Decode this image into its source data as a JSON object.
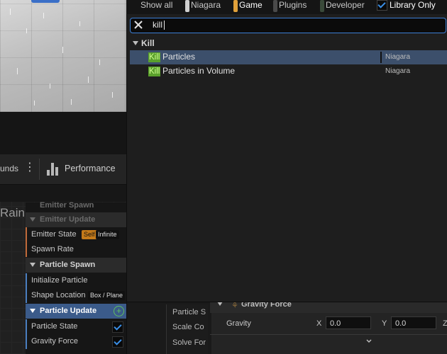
{
  "filter_bar": {
    "show_all": "Show all",
    "filters": [
      {
        "label": "Niagara",
        "color": "#cfcfcf",
        "active": false
      },
      {
        "label": "Game",
        "color": "#e0a03a",
        "active": true
      },
      {
        "label": "Plugins",
        "color": "#4a4a4a",
        "active": false
      },
      {
        "label": "Developer",
        "color": "#3a4a3a",
        "active": false
      }
    ],
    "library_only_label": "Library Only",
    "library_only_checked": true
  },
  "search": {
    "value": "kill",
    "clear_icon": "close-icon"
  },
  "results": {
    "category": "Kill",
    "items": [
      {
        "highlight": "Kill",
        "rest": "Particles",
        "source": "Niagara",
        "selected": true
      },
      {
        "highlight": "Kill",
        "rest": "Particles in Volume",
        "source": "Niagara",
        "selected": false
      }
    ]
  },
  "editor": {
    "toolbar": {
      "partial_label": "unds",
      "more_icon": "more-vertical-icon",
      "performance_icon": "bar-chart-icon",
      "performance_label": "Performance"
    },
    "graph_partial_label": "Rain",
    "stack": {
      "emitter_spawn": "Emitter Spawn",
      "emitter_update": "Emitter Update",
      "emitter_state": "Emitter State",
      "emitter_state_badge_self": "Self",
      "emitter_state_badge_infinite": "Infinite",
      "spawn_rate": "Spawn Rate",
      "particle_spawn": "Particle Spawn",
      "initialize_particle": "Initialize Particle",
      "shape_location": "Shape Location",
      "shape_location_badge": "Box / Plane",
      "particle_update": "Particle Update",
      "particle_state": "Particle State",
      "particle_state_enabled": true,
      "gravity_force": "Gravity Force",
      "gravity_force_enabled": true,
      "accent_colors": {
        "emitter": "#c06a3a",
        "particle": "#4a7fc0",
        "badge_self": "#c47a1a"
      }
    },
    "node_list": [
      "Particle S",
      "Scale Co",
      "Solve For"
    ],
    "details": {
      "section": "Gravity Force",
      "gravity_label": "Gravity",
      "x_label": "X",
      "x_value": "0.0",
      "y_label": "Y",
      "y_value": "0.0",
      "z_label": "Z"
    }
  }
}
